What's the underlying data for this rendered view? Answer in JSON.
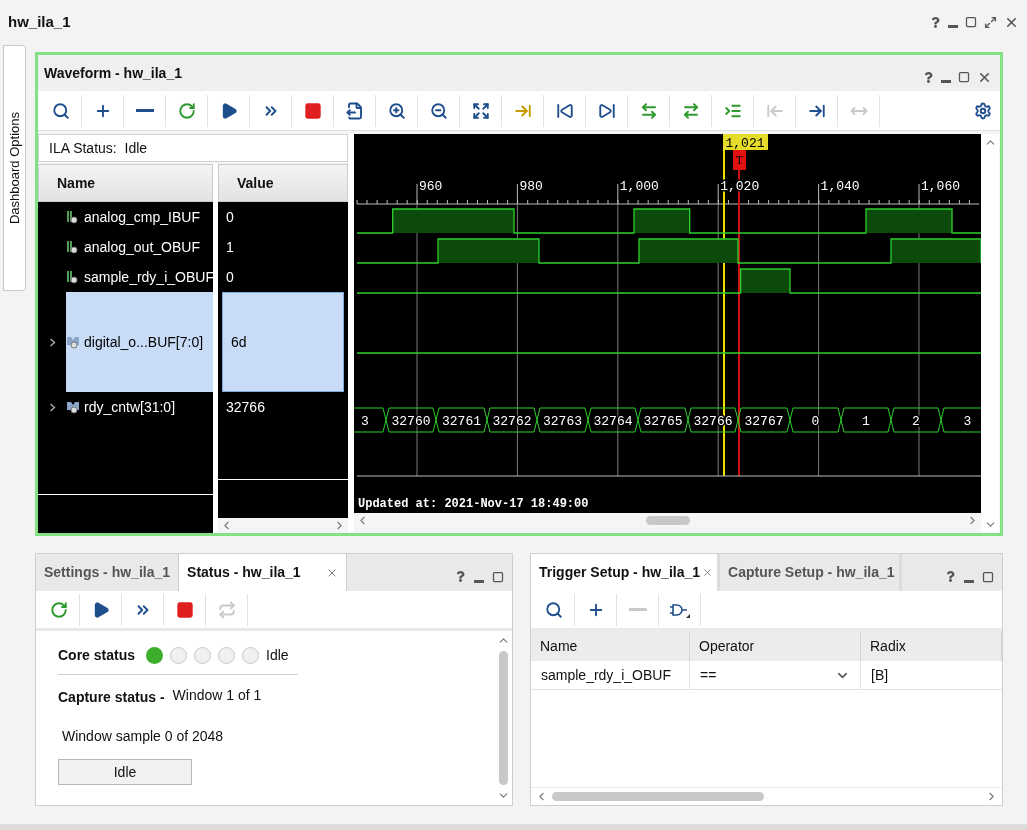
{
  "window": {
    "title": "hw_ila_1"
  },
  "side_tab": {
    "label": "Dashboard Options"
  },
  "waveform": {
    "title": "Waveform - hw_ila_1",
    "toolbar": [
      {
        "disabled": false
      },
      {
        "disabled": false
      },
      {
        "disabled": false
      },
      {
        "disabled": false
      },
      {
        "disabled": false
      },
      {
        "disabled": false
      },
      {
        "disabled": false
      },
      {
        "disabled": false
      },
      {
        "disabled": false
      },
      {
        "disabled": false
      },
      {
        "disabled": false
      },
      {
        "disabled": false
      },
      {
        "disabled": false
      },
      {
        "disabled": false
      },
      {
        "disabled": false
      },
      {
        "disabled": false
      },
      {
        "disabled": false
      },
      {
        "disabled": true
      },
      {
        "disabled": false
      },
      {
        "disabled": true
      }
    ],
    "ila_status": "ILA Status:  Idle",
    "columns": [
      "Name",
      "Value"
    ],
    "signals": [
      {
        "kind": "bit",
        "name": "analog_cmp_IBUF",
        "value": "0",
        "selected": false
      },
      {
        "kind": "bit",
        "name": "analog_out_OBUF",
        "value": "1",
        "selected": false
      },
      {
        "kind": "bit",
        "name": "sample_rdy_i_OBUF",
        "value": "0",
        "selected": false
      },
      {
        "kind": "bus",
        "name": "digital_o...BUF[7:0]",
        "value": "6d",
        "selected": true,
        "expanded": false
      },
      {
        "kind": "bus",
        "name": "rdy_cntw[31:0]",
        "value": "32766",
        "selected": false,
        "expanded": false,
        "wave_values": [
          "3",
          "32760",
          "32761",
          "32762",
          "32763",
          "32764",
          "32765",
          "32766",
          "32767",
          "0",
          "1",
          "2",
          "3"
        ]
      }
    ],
    "ticks": [
      "960",
      "980",
      "1,000",
      "1,020",
      "1,040",
      "1,060"
    ],
    "cursor_label": "1,021",
    "trigger_marker": "T",
    "updated": "Updated at: 2021-Nov-17 18:49:00"
  },
  "status_panel": {
    "tabs": [
      {
        "label": "Settings - hw_ila_1",
        "selected": false
      },
      {
        "label": "Status - hw_ila_1",
        "selected": true
      }
    ],
    "toolbar": [
      {
        "disabled": false
      },
      {
        "disabled": false
      },
      {
        "disabled": false
      },
      {
        "disabled": false
      },
      {
        "disabled": true
      }
    ],
    "core_status_label": "Core status",
    "core_dots": [
      {
        "on": true
      },
      {
        "on": false
      },
      {
        "on": false
      },
      {
        "on": false
      },
      {
        "on": false
      }
    ],
    "core_status": "Idle",
    "capture_status_label": "Capture status -",
    "capture_status": "Window 1 of 1",
    "window_sample": "Window sample 0 of 2048",
    "button": "Idle"
  },
  "trigger_panel": {
    "tabs": [
      {
        "label": "Trigger Setup - hw_ila_1",
        "selected": true
      },
      {
        "label": "Capture Setup - hw_ila_1",
        "selected": false
      }
    ],
    "toolbar": [
      {
        "disabled": false
      },
      {
        "disabled": false
      },
      {
        "disabled": true
      },
      {
        "disabled": false
      }
    ],
    "columns": [
      "Name",
      "Operator",
      "Radix"
    ],
    "rows": [
      {
        "name": "sample_rdy_i_OBUF",
        "operator": "==",
        "radix": "[B]"
      }
    ]
  }
}
